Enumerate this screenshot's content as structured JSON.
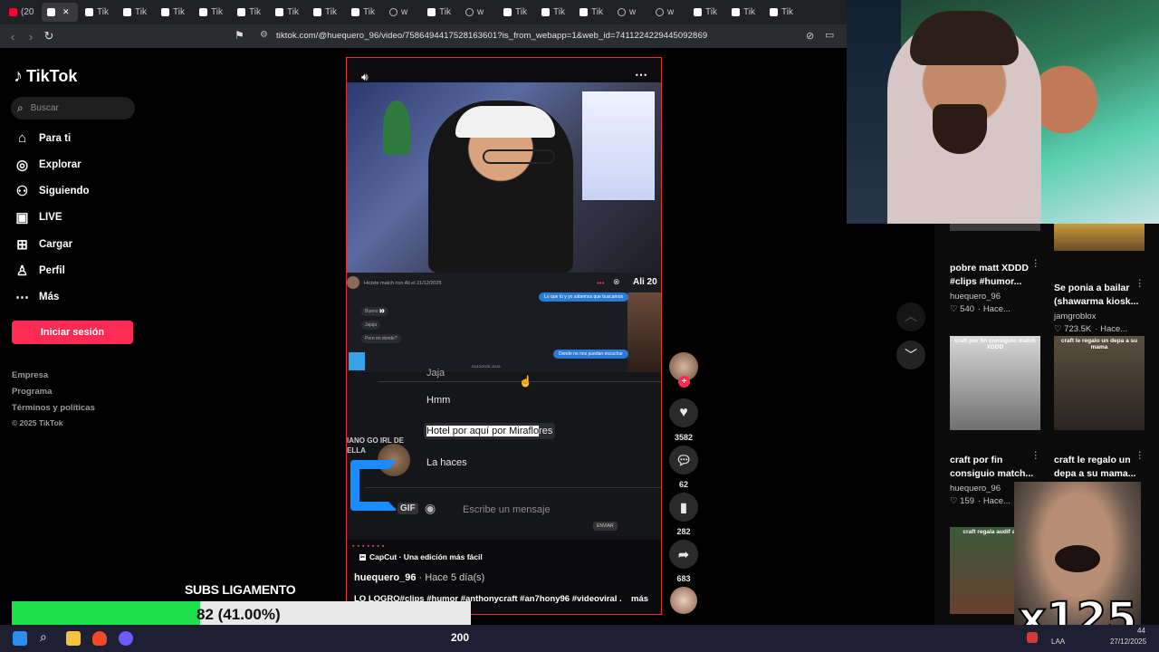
{
  "browser": {
    "tabs": [
      {
        "icon": "youtube-icon",
        "label": "(20",
        "active": false
      },
      {
        "icon": "tiktok-icon",
        "label": "",
        "active": true
      },
      {
        "icon": "tiktok-icon",
        "label": "Tik",
        "active": false
      },
      {
        "icon": "tiktok-icon",
        "label": "Tik",
        "active": false
      },
      {
        "icon": "tiktok-icon",
        "label": "Tik",
        "active": false
      },
      {
        "icon": "tiktok-icon",
        "label": "Tik",
        "active": false
      },
      {
        "icon": "tiktok-icon",
        "label": "Tik",
        "active": false
      },
      {
        "icon": "tiktok-icon",
        "label": "Tik",
        "active": false
      },
      {
        "icon": "tiktok-icon",
        "label": "Tik",
        "active": false
      },
      {
        "icon": "tiktok-icon",
        "label": "Tik",
        "active": false
      },
      {
        "icon": "globe-icon",
        "label": "w",
        "active": false
      },
      {
        "icon": "tiktok-icon",
        "label": "Tik",
        "active": false
      },
      {
        "icon": "globe-icon",
        "label": "w",
        "active": false
      },
      {
        "icon": "tiktok-icon",
        "label": "Tik",
        "active": false
      },
      {
        "icon": "tiktok-icon",
        "label": "Tik",
        "active": false
      },
      {
        "icon": "tiktok-icon",
        "label": "Tik",
        "active": false
      },
      {
        "icon": "globe-icon",
        "label": "w",
        "active": false
      },
      {
        "icon": "globe-icon",
        "label": "w",
        "active": false
      },
      {
        "icon": "tiktok-icon",
        "label": "Tik",
        "active": false
      },
      {
        "icon": "tiktok-icon",
        "label": "Tik",
        "active": false
      },
      {
        "icon": "tiktok-icon",
        "label": "Tik",
        "active": false
      }
    ],
    "url": "tiktok.com/@huequero_96/video/7586494417528163601?is_from_webapp=1&web_id=7411224229445092869"
  },
  "sidebar": {
    "logo": "TikTok",
    "search_placeholder": "Buscar",
    "nav": [
      {
        "label": "Para ti",
        "icon": "home-icon"
      },
      {
        "label": "Explorar",
        "icon": "compass-icon"
      },
      {
        "label": "Siguiendo",
        "icon": "following-icon"
      },
      {
        "label": "LIVE",
        "icon": "live-icon"
      },
      {
        "label": "Cargar",
        "icon": "upload-icon"
      },
      {
        "label": "Perfil",
        "icon": "profile-icon"
      },
      {
        "label": "Más",
        "icon": "more-icon"
      }
    ],
    "login": "Iniciar sesión",
    "footer": [
      "Empresa",
      "Programa",
      "Términos y políticas",
      "© 2025 TikTok"
    ]
  },
  "video": {
    "chat_header": "Hiciste match con Ali el 21/12/2025",
    "chat_name": "Ali 20",
    "chat_small": [
      "Lo que tú y yo sabemos que buscamos",
      "Bueno 👀",
      "Jajaja",
      "Pero en donde?",
      "Donde no nos puedan escuchar",
      "21/12/2025, 20:11"
    ],
    "partial_top": "Jaja",
    "bubble_1": "Hmm",
    "bubble_2_selected": "Hotel por aquí por Miraflo",
    "bubble_2_rest": "res",
    "bubble_3": "La haces",
    "message_placeholder": "Escribe un mensaje",
    "gif_label": "GIF",
    "send_label": "ENVIAR",
    "overlay_text": "IANO GO IRL DE\nELLA",
    "capcut": "CapCut · Una edición más fácil",
    "author": "huequero_96",
    "time": "· Hace 5 día(s)",
    "description": "LO LOGRO#clips #humor #anthonycraft #an7hony96 #videoviral ...",
    "more": "más"
  },
  "actions": {
    "likes": "3582",
    "comments": "62",
    "saves": "282",
    "shares": "683"
  },
  "related": [
    {
      "title": "pobre matt XDDD #clips #humor...",
      "author": "huequero_96",
      "views": "540",
      "age": "· Hace...",
      "thumb_caption": ""
    },
    {
      "title": "Se ponia a bailar (shawarma kiosk...",
      "author": "jamgroblox",
      "views": "723.5K",
      "age": "· Hace...",
      "thumb_caption": ""
    },
    {
      "title": "craft por fin consiguio match...",
      "author": "huequero_96",
      "views": "159",
      "age": "· Hace...",
      "thumb_caption": "craft por fin consiguio match XDDD"
    },
    {
      "title": "craft le regalo un depa a su mama...",
      "author": "",
      "views": "",
      "age": "",
      "thumb_caption": "craft le regalo un depa a su mama"
    },
    {
      "title": "",
      "author": "",
      "views": "",
      "age": "",
      "thumb_caption": "craft regala audif a sub"
    }
  ],
  "overlay": {
    "subs_title": "SUBS LIGAMENTO",
    "subs_text": "82 (41.00%)",
    "subs_progress": 0.41,
    "viewer_count": "200",
    "meme_multiplier": "x125"
  },
  "taskbar": {
    "lang": "LAA",
    "time": "44",
    "date": "27/12/2025"
  },
  "colors": {
    "tiktok_red": "#fe2c55",
    "video_border": "#e2352c",
    "progress_green": "#1ee04a"
  }
}
